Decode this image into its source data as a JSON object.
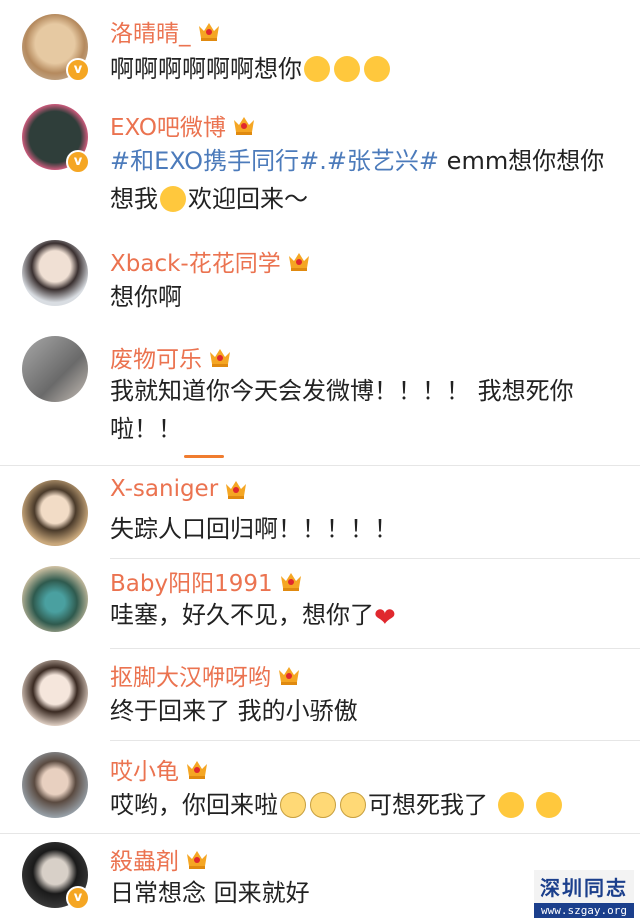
{
  "comments": [
    {
      "username": "洛晴晴_",
      "text": "啊啊啊啊啊啊想你",
      "emojis": [
        "crying-face",
        "crying-face",
        "crying-face"
      ],
      "verified": true,
      "avatar_color": "#c8a27a"
    },
    {
      "username": "EXO吧微博",
      "tags": [
        "#和EXO携手同行#",
        ".#张艺兴#"
      ],
      "text_after_tags": " emm想你想你想我",
      "text_end": "欢迎回来～",
      "emoji": "laughing-face",
      "verified": true,
      "avatar_color": "#1e2a2a"
    },
    {
      "username": "Xback-花花同学",
      "text": "想你啊",
      "avatar_color": "#d9dde2"
    },
    {
      "username": "废物可乐",
      "text": "我就知道你今天会发微博！！！！ 我想死你啦！！",
      "avatar_color": "#8c8c8c"
    },
    {
      "username": "X-saniger",
      "text": "失踪人口回归啊！！！！！",
      "avatar_color": "#c9a87c"
    },
    {
      "username": "Baby阳阳1991",
      "text": "哇塞，好久不见，想你了",
      "heart": "❤",
      "avatar_color": "#2f5a4e"
    },
    {
      "username": "抠脚大汉咿呀哟",
      "text": "终于回来了 我的小骄傲",
      "avatar_color": "#e8d8cc"
    },
    {
      "username": "哎小龟",
      "text_before": "哎哟，你回来啦",
      "text_after": "可想死我了",
      "emojis": [
        "sad-face",
        "sad-face",
        "sad-face",
        "shy-face",
        "shy-face"
      ],
      "avatar_color": "#9ca7b0"
    },
    {
      "username": "殺蟲剤",
      "text": "日常想念 回来就好",
      "verified": true,
      "avatar_color": "#3a3a3a"
    }
  ],
  "watermark": {
    "title": "深圳同志",
    "url": "www.szgay.org"
  },
  "colors": {
    "username": "#eb7350",
    "tag": "#4c7bbb",
    "crown": "#f5a623",
    "verified": "#f5a623"
  }
}
